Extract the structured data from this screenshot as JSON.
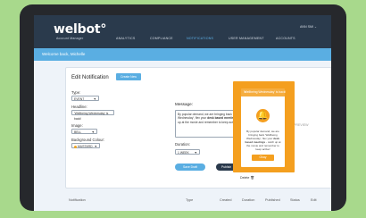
{
  "app": {
    "logo": "welbot",
    "logo_mark": "°",
    "logo_sub": "Account Manager"
  },
  "nav": {
    "items": [
      {
        "label": "ANALYTICS"
      },
      {
        "label": "COMPLIANCE"
      },
      {
        "label": "NOTIFICATIONS",
        "active": true
      },
      {
        "label": "USER MANAGEMENT"
      },
      {
        "label": "ACCOUNTS"
      }
    ],
    "user": "ANN SMI ⌄"
  },
  "welcome": "Welcome back, Michelle",
  "form": {
    "title": "Edit Notification",
    "create_new": "Create New",
    "type": {
      "label": "Type:",
      "value": "EVENT"
    },
    "headline": {
      "label": "Headline:",
      "value": "'Wellbeing Wednesday' is back!"
    },
    "image": {
      "label": "Image:",
      "value": "BELL"
    },
    "bg": {
      "label": "Background Colour:",
      "value": "MUSTARD"
    },
    "message": {
      "label": "Message:",
      "counter": "140/140",
      "text_pre": "By popular demand, we are bringing back 'Wellbeing Wednesday', flex your ",
      "text_bold": "desk based meetings",
      "text_post": " - catch up at the movie and remember to keep active!"
    },
    "duration": {
      "label": "Duration:",
      "value": "1 WEEK"
    },
    "save_draft": "Save Draft",
    "publish": "Publish",
    "publish_caret": "▾",
    "delete": "Delete",
    "delete_icon": "🗑"
  },
  "preview": {
    "label": "PREVIEW",
    "modal_title": "'Wellbeing Wednesday' is back!",
    "close": "✕",
    "icon": "bell-icon",
    "icon_glyph": "🔔",
    "text_pre": "By popular demand, we are bringing back 'Wellbeing Wednesday', flex your ",
    "text_bold": "desk based meetings",
    "text_post": " - catch up at the movie and remember to keep active!",
    "okay": "Okay"
  },
  "table": {
    "headers": [
      "Notification",
      "Type",
      "Created",
      "Duration",
      "Published",
      "Status",
      "Edit"
    ]
  },
  "colors": {
    "accent": "#5aaee2",
    "nav": "#2a3a4c",
    "mustard": "#f49f1f",
    "background": "#a8d98c"
  }
}
